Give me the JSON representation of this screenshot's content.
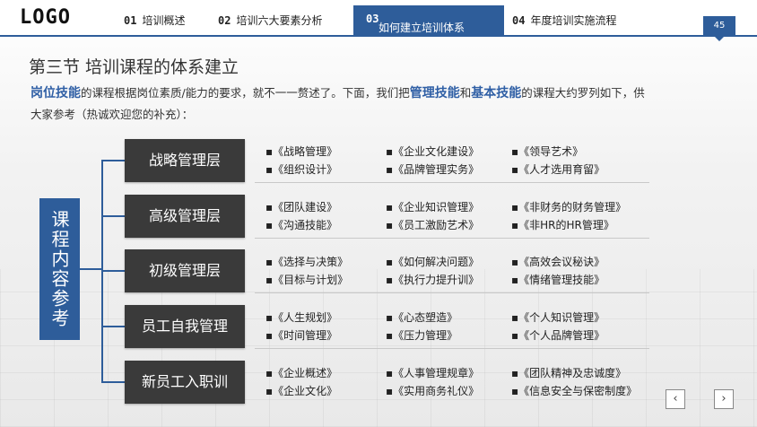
{
  "header": {
    "logo": "LOGO",
    "tabs": [
      {
        "num": "01",
        "label": "培训概述"
      },
      {
        "num": "02",
        "label": "培训六大要素分析"
      },
      {
        "num": "03",
        "label": "如何建立培训体系"
      },
      {
        "num": "04",
        "label": "年度培训实施流程"
      }
    ],
    "page_number": "45"
  },
  "title": "第三节  培训课程的体系建立",
  "description": {
    "hl1": "岗位技能",
    "t1": "的课程根据岗位素质/能力的要求，就不一一赘述了。下面，我们把",
    "hl2": "管理技能",
    "t2": "和",
    "hl3": "基本技能",
    "t3": "的课程大约罗列如下，供大家参考（热诚欢迎您的补充）："
  },
  "side_label": "课程内容参考",
  "levels": [
    {
      "name": "战略管理层",
      "courses": [
        "《战略管理》",
        "《企业文化建设》",
        "《领导艺术》",
        "《组织设计》",
        "《品牌管理实务》",
        "《人才选用育留》"
      ]
    },
    {
      "name": "高级管理层",
      "courses": [
        "《团队建设》",
        "《企业知识管理》",
        "《非财务的财务管理》",
        "《沟通技能》",
        "《员工激励艺术》",
        "《非HR的HR管理》"
      ]
    },
    {
      "name": "初级管理层",
      "courses": [
        "《选择与决策》",
        "《如何解决问题》",
        "《高效会议秘诀》",
        "《目标与计划》",
        "《执行力提升训》",
        "《情绪管理技能》"
      ]
    },
    {
      "name": "员工自我管理",
      "courses": [
        "《人生规划》",
        "《心态塑造》",
        "《个人知识管理》",
        "《时间管理》",
        "《压力管理》",
        "《个人品牌管理》"
      ]
    },
    {
      "name": "新员工入职训",
      "courses": [
        "《企业概述》",
        "《人事管理规章》",
        "《团队精神及忠诚度》",
        "《企业文化》",
        "《实用商务礼仪》",
        "《信息安全与保密制度》"
      ]
    }
  ],
  "nav": {
    "prev": "‹",
    "next": "›"
  },
  "colors": {
    "accent": "#2e5d9a",
    "level_box": "#3a3a3a",
    "highlight": "#2f5fa5"
  }
}
